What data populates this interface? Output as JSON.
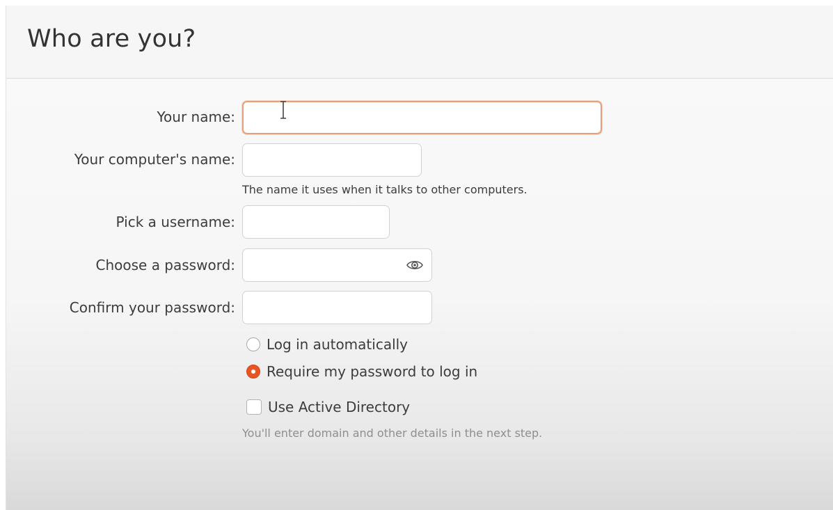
{
  "header": {
    "title": "Who are you?"
  },
  "form": {
    "your_name": {
      "label": "Your name:",
      "value": "",
      "placeholder": ""
    },
    "computer_name": {
      "label": "Your computer's name:",
      "value": "",
      "hint": "The name it uses when it talks to other computers."
    },
    "username": {
      "label": "Pick a username:",
      "value": ""
    },
    "password": {
      "label": "Choose a password:",
      "value": "",
      "icon": "eye-icon"
    },
    "confirm_password": {
      "label": "Confirm your password:",
      "value": ""
    },
    "login_options": [
      {
        "label": "Log in automatically",
        "selected": false
      },
      {
        "label": "Require my password to log in",
        "selected": true
      }
    ],
    "active_directory": {
      "label": "Use Active Directory",
      "checked": false,
      "hint": "You'll enter domain and other details in the next step."
    }
  },
  "colors": {
    "accent": "#E95420",
    "focus_border": "#E8A07A"
  }
}
